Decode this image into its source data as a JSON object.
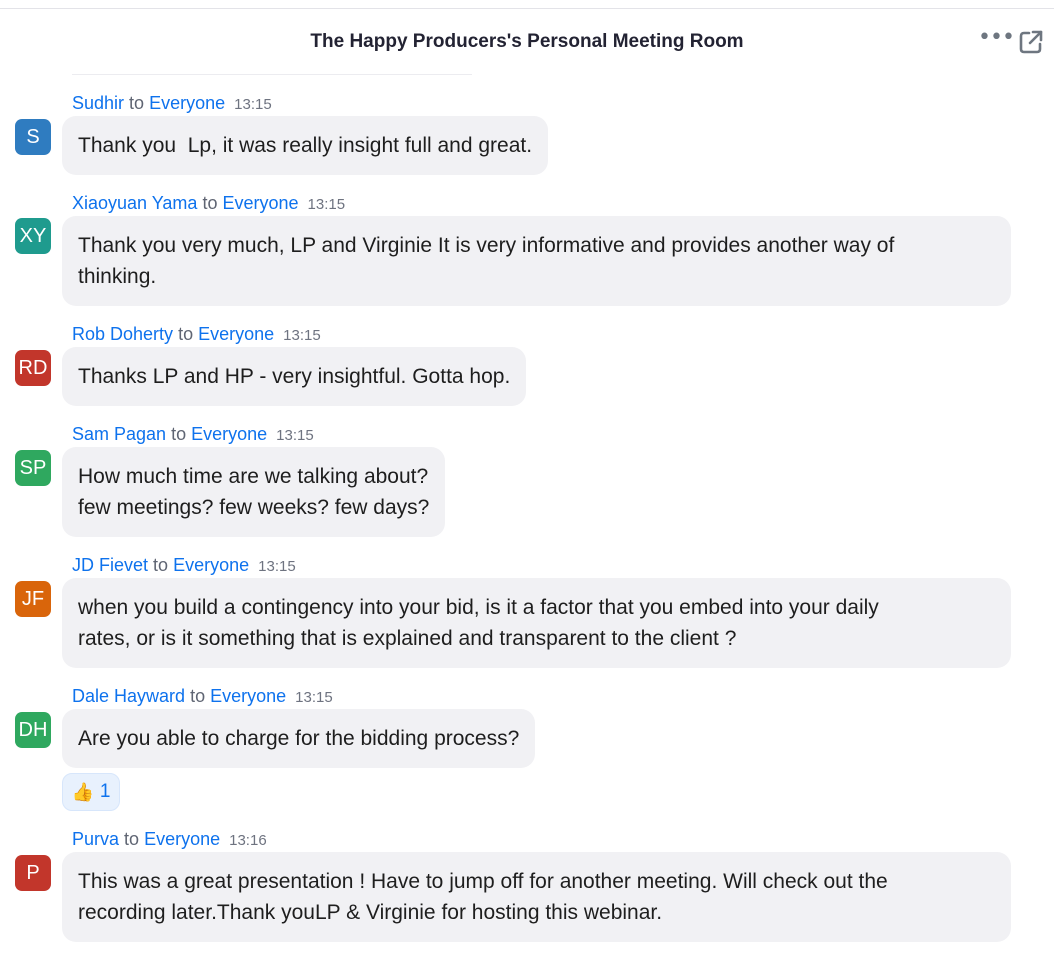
{
  "header": {
    "title": "The Happy Producers's Personal Meeting Room",
    "more_icon": "more-horizontal-icon",
    "popout_icon": "popout-icon"
  },
  "messages": [
    {
      "sender": "Sudhir",
      "to": "to",
      "recipient": "Everyone",
      "time": "13:15",
      "avatar_initials": "S",
      "avatar_color": "#2f7cc0",
      "text": "Thank you  Lp, it was really insight full and great."
    },
    {
      "sender": "Xiaoyuan Yama",
      "to": "to",
      "recipient": "Everyone",
      "time": "13:15",
      "avatar_initials": "XY",
      "avatar_color": "#1f9b8e",
      "text": "Thank you very much, LP and Virginie It is very informative and provides another way of\nthinking."
    },
    {
      "sender": "Rob Doherty",
      "to": "to",
      "recipient": "Everyone",
      "time": "13:15",
      "avatar_initials": "RD",
      "avatar_color": "#c2362b",
      "text": "Thanks LP and HP - very insightful. Gotta hop."
    },
    {
      "sender": "Sam Pagan",
      "to": "to",
      "recipient": "Everyone",
      "time": "13:15",
      "avatar_initials": "SP",
      "avatar_color": "#2fa85f",
      "text": "How much time are we talking about?\nfew meetings? few weeks? few days?"
    },
    {
      "sender": "JD Fievet",
      "to": "to",
      "recipient": "Everyone",
      "time": "13:15",
      "avatar_initials": "JF",
      "avatar_color": "#d9650b",
      "text": "when you build a contingency into your bid, is it a factor that you embed into your daily\nrates, or is it something that is explained and transparent to the client ?"
    },
    {
      "sender": "Dale Hayward",
      "to": "to",
      "recipient": "Everyone",
      "time": "13:15",
      "avatar_initials": "DH",
      "avatar_color": "#2fa85f",
      "text": "Are you able to charge for the bidding process?",
      "reaction": {
        "icon": "thumbs-up-icon",
        "glyph": "👍",
        "count": "1"
      }
    },
    {
      "sender": "Purva ",
      "to": "to",
      "recipient": "Everyone",
      "time": "13:16",
      "avatar_initials": "P",
      "avatar_color": "#c2362b",
      "text": "This was a great presentation ! Have to jump off for another meeting. Will check out the\nrecording later.Thank youLP & Virginie for hosting this webinar."
    }
  ]
}
